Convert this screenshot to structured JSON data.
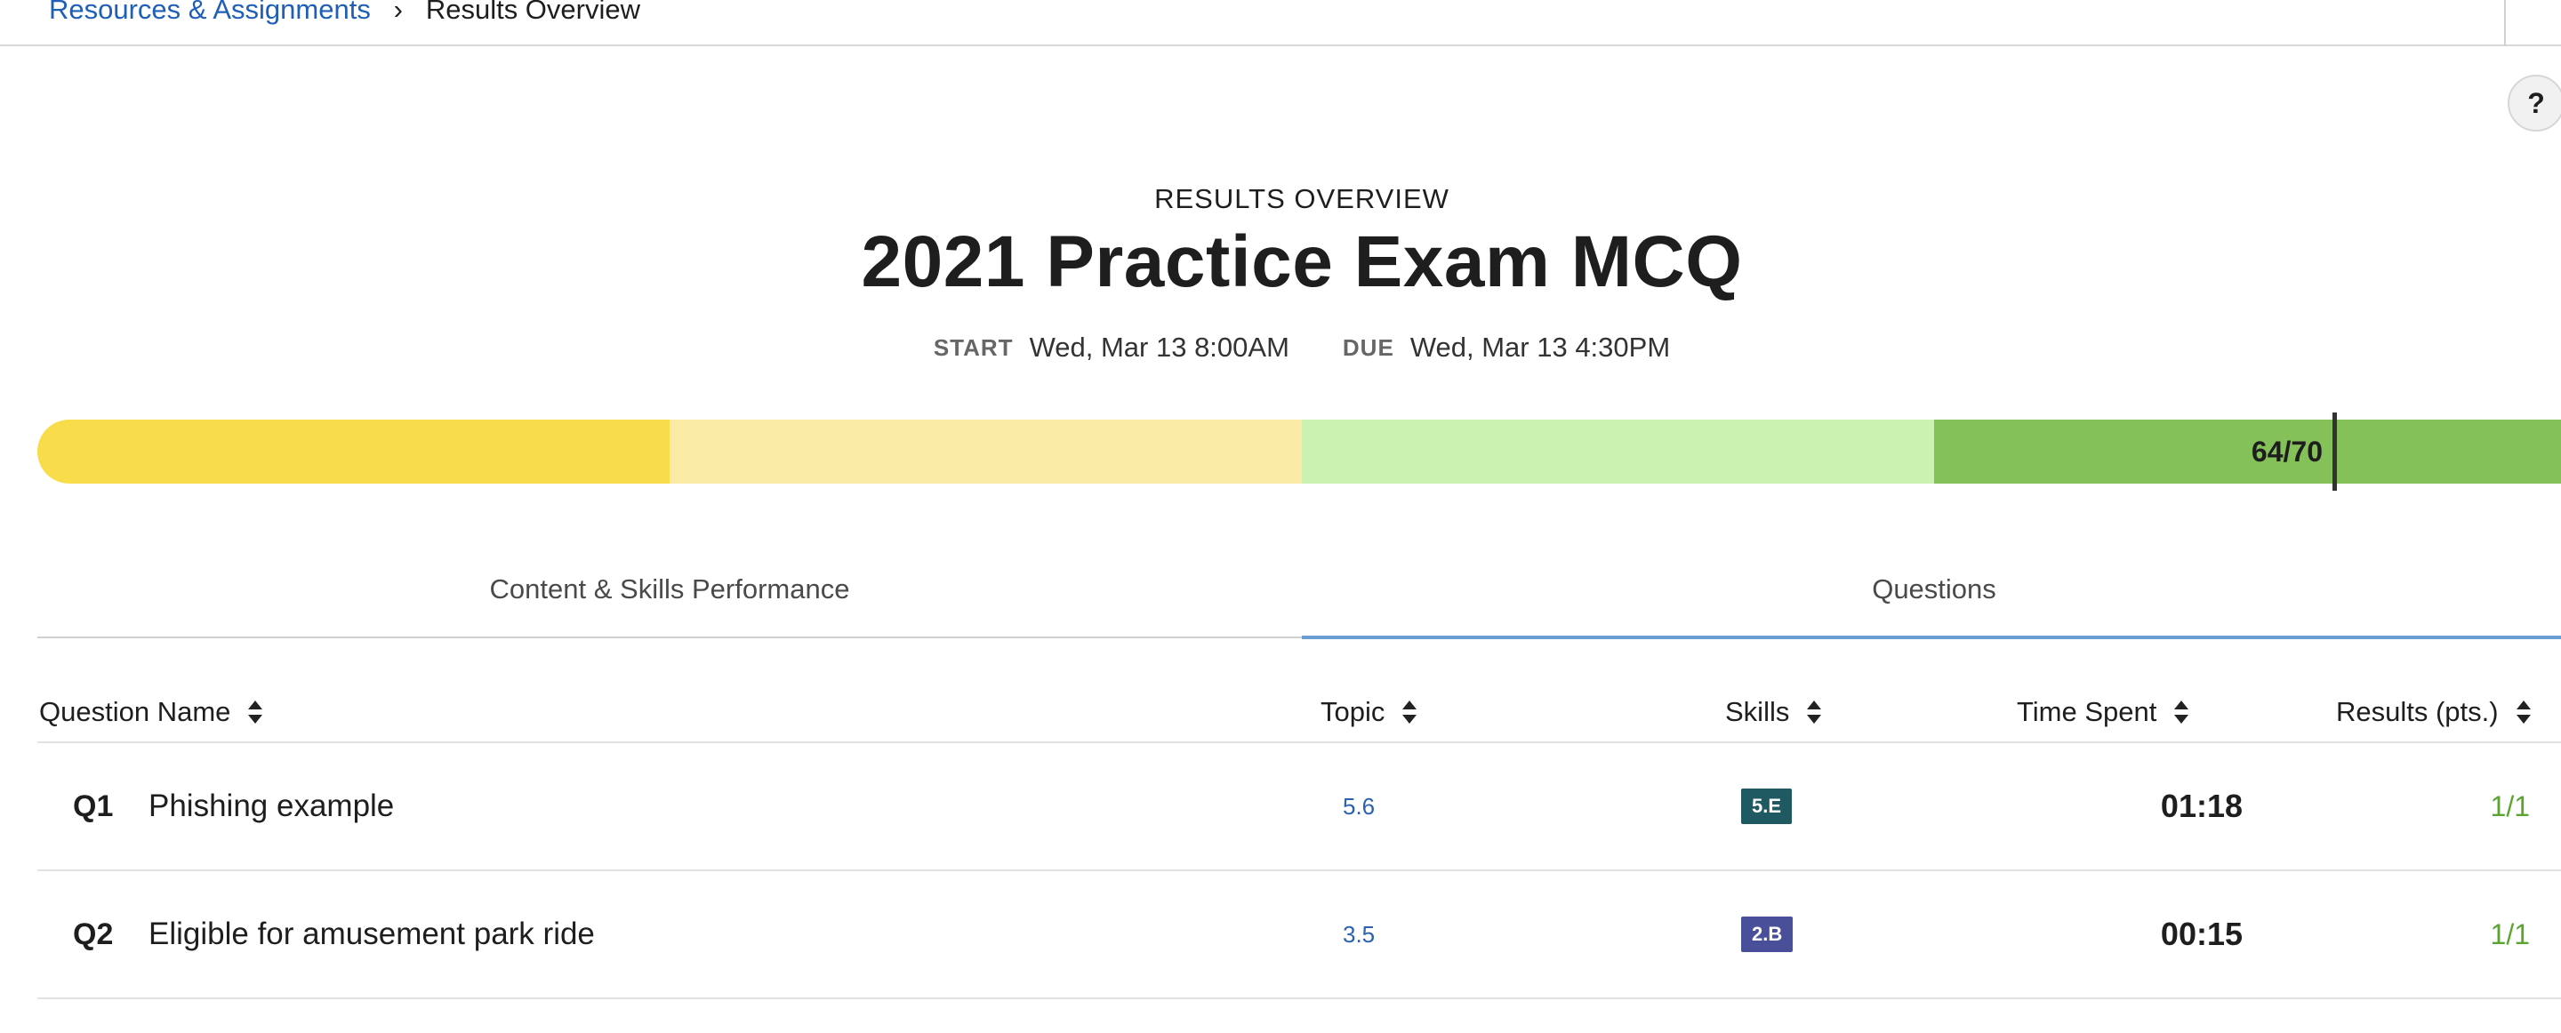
{
  "breadcrumb": {
    "parent": "Resources & Assignments",
    "separator": "›",
    "current": "Results Overview"
  },
  "help": {
    "label": "?"
  },
  "header": {
    "eyebrow": "RESULTS OVERVIEW",
    "title": "2021 Practice Exam MCQ",
    "start_label": "START",
    "start_value": "Wed, Mar 13 8:00AM",
    "due_label": "DUE",
    "due_value": "Wed, Mar 13 4:30PM"
  },
  "score": {
    "label": "64/70",
    "earned": 64,
    "possible": 70,
    "band_colors": [
      "#f8dc4a",
      "#f9eaa6",
      "#cbf2b0",
      "#85c159"
    ]
  },
  "tabs": [
    {
      "label": "Content & Skills Performance",
      "active": false
    },
    {
      "label": "Questions",
      "active": true
    }
  ],
  "table": {
    "columns": [
      {
        "label": "Question Name"
      },
      {
        "label": "Topic"
      },
      {
        "label": "Skills"
      },
      {
        "label": "Time Spent"
      },
      {
        "label": "Results (pts.)"
      }
    ],
    "rows": [
      {
        "num": "Q1",
        "name": "Phishing example",
        "topic": "5.6",
        "skill": "5.E",
        "skill_color": "#1f5a63",
        "time": "01:18",
        "result": "1/1"
      },
      {
        "num": "Q2",
        "name": "Eligible for amusement park ride",
        "topic": "3.5",
        "skill": "2.B",
        "skill_color": "#4a4f9a",
        "time": "00:15",
        "result": "1/1"
      }
    ]
  }
}
